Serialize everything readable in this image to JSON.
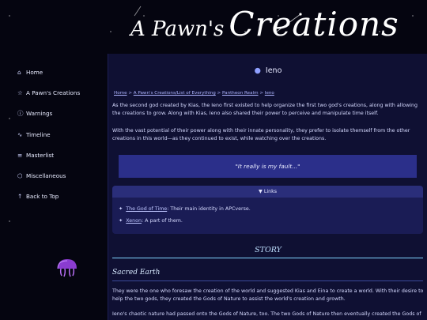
{
  "header": {
    "logo_part1": "A Pawn's",
    "logo_part2": "Creations"
  },
  "sidebar": {
    "items": [
      {
        "icon": "⌂",
        "label": "Home"
      },
      {
        "icon": "☆",
        "label": "A Pawn's Creations"
      },
      {
        "icon": "ⓘ",
        "label": "Warnings"
      },
      {
        "icon": "∿",
        "label": "Timeline"
      },
      {
        "icon": "≡",
        "label": "Masterlist"
      },
      {
        "icon": "⬡",
        "label": "Miscellaneous"
      },
      {
        "icon": "↑",
        "label": "Back to Top"
      }
    ]
  },
  "page": {
    "title": "Ieno",
    "breadcrumbs": [
      "Home",
      ">",
      "A Pawn's Creations/List of Everything",
      ">",
      "Pantheon Realm",
      ">",
      "Ieno"
    ],
    "paragraphs": [
      "As the second god created by Kias, the Ieno first existed to help organize the first two god's creations, along with allowing the creations to grow. Along with Kias, Ieno also shared their power to perceive and manipulate time itself.",
      "With the vast potential of their power along with their innate personality, they prefer to isolate themself from the other creations in this world—as they continued to exist, while watching over the creations."
    ],
    "quote": "\"It really is my fault...\"",
    "links": {
      "header": "▼ Links",
      "items": [
        {
          "link": "The God of Time",
          "desc": ": Their main identity in APCverse."
        },
        {
          "link": "Xenon",
          "desc": ": A part of them."
        }
      ]
    },
    "story_heading": "STORY",
    "section_title": "Sacred Earth",
    "story_paragraphs": [
      "They were the one who foresaw the creation of the world and suggested Kias and Eina to create a world. With their desire to help the two gods, they created the Gods of Nature to assist the world's creation and growth.",
      "Ieno's chaotic nature had passed onto the Gods of Nature, too. The two Gods of Nature then eventually created the Gods of"
    ]
  }
}
